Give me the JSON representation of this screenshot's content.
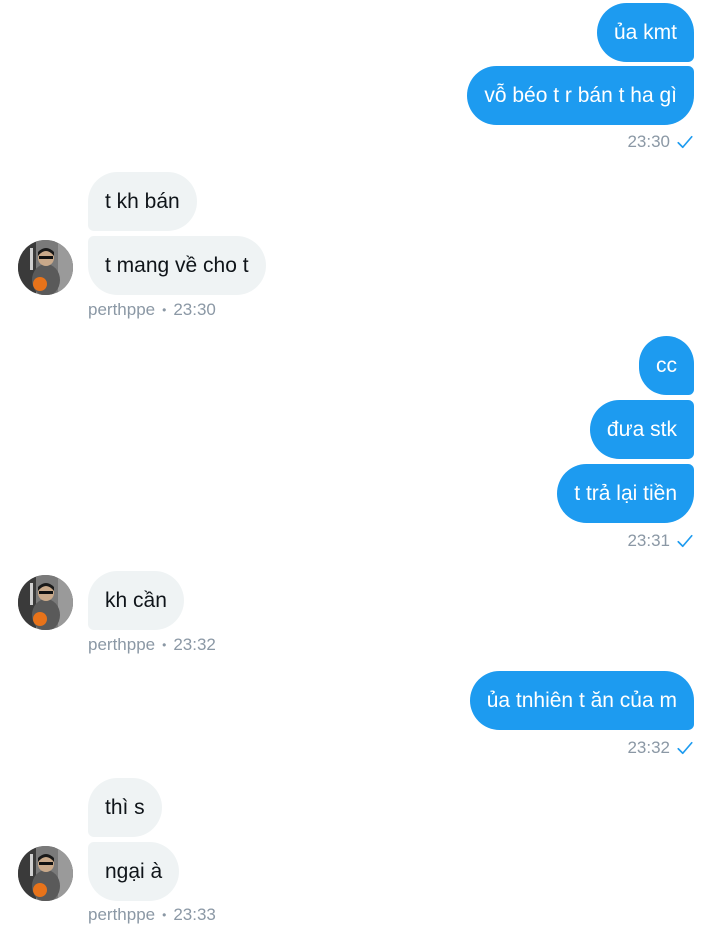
{
  "contact": {
    "username": "perthppe"
  },
  "messages": [
    {
      "id": "m1",
      "text": "ủa kmt"
    },
    {
      "id": "m2",
      "text": "vỗ béo t r bán t ha gì"
    },
    {
      "id": "m3",
      "text": "t kh bán"
    },
    {
      "id": "m4",
      "text": "t mang về cho t"
    },
    {
      "id": "m5",
      "text": "cc"
    },
    {
      "id": "m6",
      "text": "đưa stk"
    },
    {
      "id": "m7",
      "text": "t trả lại tiền"
    },
    {
      "id": "m8",
      "text": "kh cần"
    },
    {
      "id": "m9",
      "text": "ủa tnhiên t ăn của m"
    },
    {
      "id": "m10",
      "text": "thì s"
    },
    {
      "id": "m11",
      "text": "ngại à"
    }
  ],
  "timestamps": {
    "out1": "23:30",
    "in1": "23:30",
    "out2": "23:31",
    "in2": "23:32",
    "out3": "23:32",
    "in3": "23:33"
  },
  "separator": "•",
  "icons": {
    "read_receipt": "checkmark-icon",
    "avatar": "user-avatar"
  },
  "colors": {
    "outgoing_bubble": "#1d9bf0",
    "incoming_bubble": "#eff3f4",
    "meta_text": "#8b98a5"
  }
}
